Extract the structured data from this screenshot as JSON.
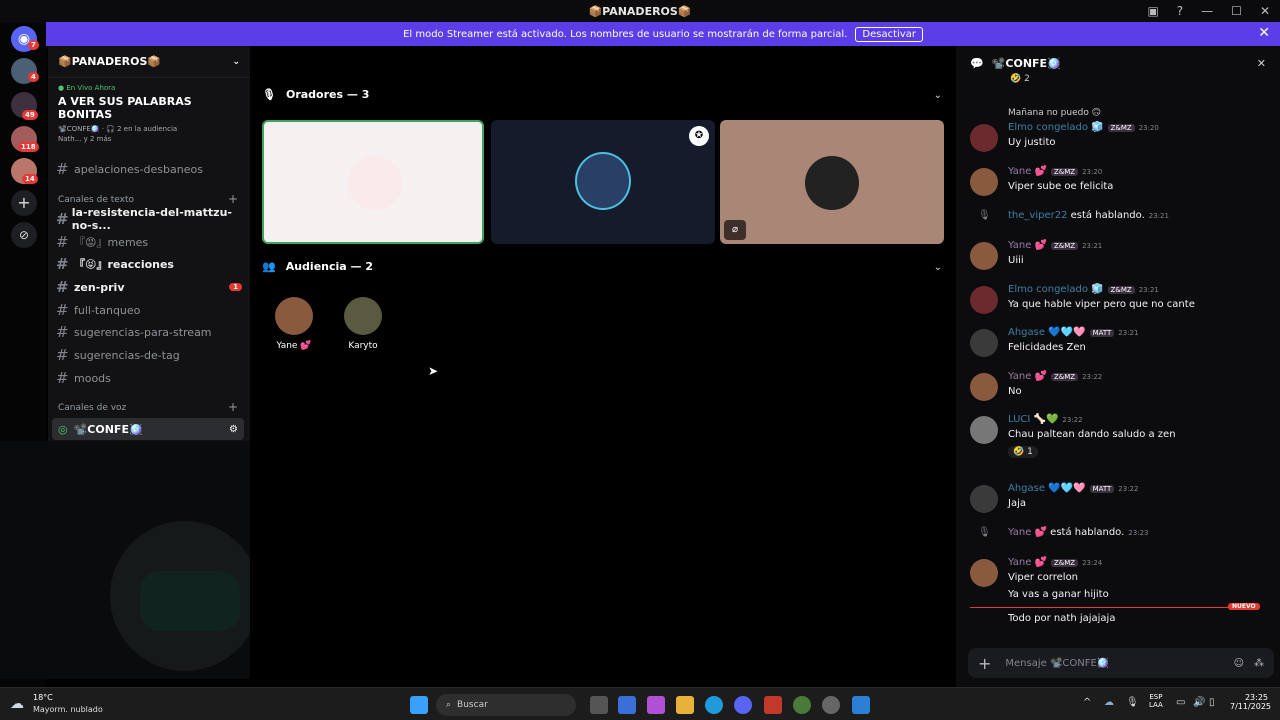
{
  "window": {
    "title": "📦PANADEROS📦"
  },
  "banner": {
    "text": "El modo Streamer está activado. Los nombres de usuario se mostrarán de forma parcial.",
    "button": "Desactivar"
  },
  "servers": {
    "badges": [
      "7",
      "4",
      "49",
      "118",
      "14"
    ]
  },
  "sidebar": {
    "server_name": "📦PANADEROS📦",
    "live_label": "En Vivo Ahora",
    "live_title": "A VER SUS PALABRAS BONITAS",
    "live_info": "📽️CONFE🪩 · 🎧 2 en la audiencia",
    "live_people": "Nath... y 2 más",
    "channels_top": [
      {
        "name": "apelaciones-desbaneos"
      }
    ],
    "text_category": "Canales de texto",
    "text_channels": [
      {
        "name": "la-resistencia-del-mattzu-no-s...",
        "bold": true
      },
      {
        "name": "『😡』memes",
        "bold": false
      },
      {
        "name": "『😝』reacciones",
        "bold": true
      },
      {
        "name": "zen-priv",
        "bold": true,
        "badge": "1"
      },
      {
        "name": "full-tanqueo",
        "bold": false
      },
      {
        "name": "sugerencias-para-stream",
        "bold": false
      },
      {
        "name": "sugerencias-de-tag",
        "bold": false
      },
      {
        "name": "moods",
        "bold": false
      }
    ],
    "voice_category": "Canales de voz",
    "voice_channel": "📽️CONFE🪩",
    "voice_sub": "A VER SUS PALABRAS BONITAS"
  },
  "stage": {
    "speakers_label": "Oradores — 3",
    "audience_label": "Audiencia — 2",
    "audience": [
      {
        "name": "Yane 💕"
      },
      {
        "name": "Karyto"
      }
    ]
  },
  "chat": {
    "title": "📽️CONFE🪩",
    "reply_preview": "Mañana no puedo 🙃",
    "messages": [
      {
        "name": "Elmo congelado 🧊",
        "tag": "Z&MZ",
        "time": "23:20",
        "text": "Uy justito",
        "color": "#3e7fa8"
      },
      {
        "name": "Yane 💕",
        "tag": "Z&MZ",
        "time": "23:20",
        "text": "Viper sube oe felicita",
        "color": "#9b7aa6"
      },
      {
        "name": "the_viper22",
        "tag": "",
        "time": "23:21",
        "text": "está hablando.",
        "color": "#3e7fa8",
        "system": true
      },
      {
        "name": "Yane 💕",
        "tag": "Z&MZ",
        "time": "23:21",
        "text": "Uiii",
        "color": "#9b7aa6"
      },
      {
        "name": "Elmo congelado 🧊",
        "tag": "Z&MZ",
        "time": "23:21",
        "text": "Ya que hable viper pero que no cante",
        "color": "#3e7fa8"
      },
      {
        "name": "Ahgase 💙🩵🩷",
        "tag": "MATT",
        "time": "23:21",
        "text": "Felicidades Zen",
        "color": "#3e7fa8"
      },
      {
        "name": "Yane 💕",
        "tag": "Z&MZ",
        "time": "23:22",
        "text": "No",
        "color": "#9b7aa6"
      },
      {
        "name": "LUCI 🦴💚",
        "tag": "",
        "time": "23:22",
        "text": "Chau paltean  dando saludo a zen",
        "color": "#3e7fa8"
      },
      {
        "name": "Ahgase 💙🩵🩷",
        "tag": "MATT",
        "time": "23:22",
        "text": "Jaja",
        "color": "#3e7fa8"
      },
      {
        "name": "Yane 💕",
        "tag": "",
        "time": "23:23",
        "text": "está hablando.",
        "color": "#9b7aa6",
        "system": true
      },
      {
        "name": "Yane 💕",
        "tag": "Z&MZ",
        "time": "23:24",
        "text": "Viper correlon",
        "color": "#9b7aa6"
      }
    ],
    "extra_lines": [
      "Ya vas a ganar hijito",
      "Todo por nath jajajaja"
    ],
    "reaction_top": "2",
    "reaction_luci": "1",
    "new_label": "NUEVO",
    "input_placeholder": "Mensaje 📽️CONFE🪩"
  },
  "taskbar": {
    "weather_temp": "18°C",
    "weather_desc": "Mayorm. nublado",
    "search": "Buscar",
    "lang": "ESP",
    "lang2": "LAA",
    "time": "23:25",
    "date": "7/11/2025"
  }
}
